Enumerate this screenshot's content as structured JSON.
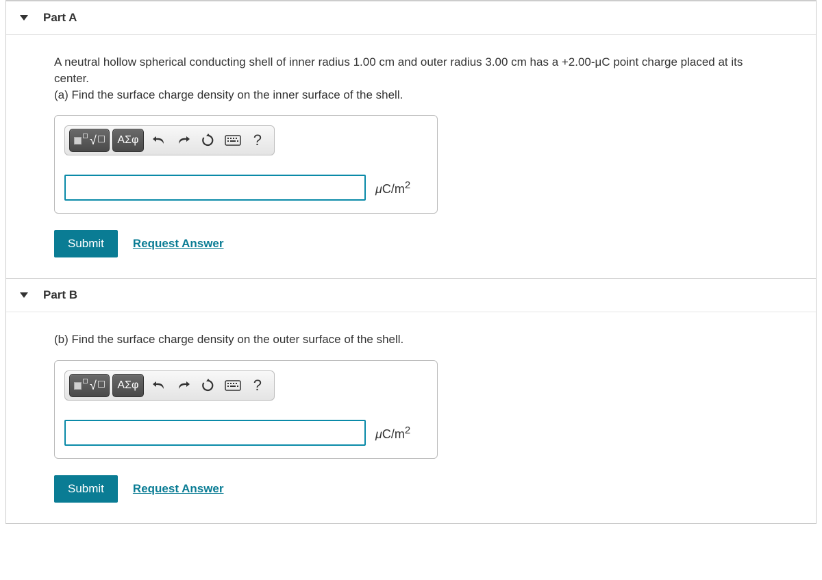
{
  "partA": {
    "title": "Part A",
    "problem_line1": "A neutral hollow spherical conducting shell of inner radius 1.00 cm and outer radius 3.00 cm has a +2.00-μC point charge placed at its center.",
    "problem_line2": "(a) Find the surface charge density on the inner surface of the shell.",
    "toolbar": {
      "greek_label": "ΑΣφ",
      "help_label": "?"
    },
    "unit_prefix": "μ",
    "unit_text": "C/m",
    "unit_exp": "2",
    "submit_label": "Submit",
    "request_label": "Request Answer"
  },
  "partB": {
    "title": "Part B",
    "problem_line1": "(b) Find the surface charge density on the outer surface of the shell.",
    "toolbar": {
      "greek_label": "ΑΣφ",
      "help_label": "?"
    },
    "unit_prefix": "μ",
    "unit_text": "C/m",
    "unit_exp": "2",
    "submit_label": "Submit",
    "request_label": "Request Answer"
  }
}
